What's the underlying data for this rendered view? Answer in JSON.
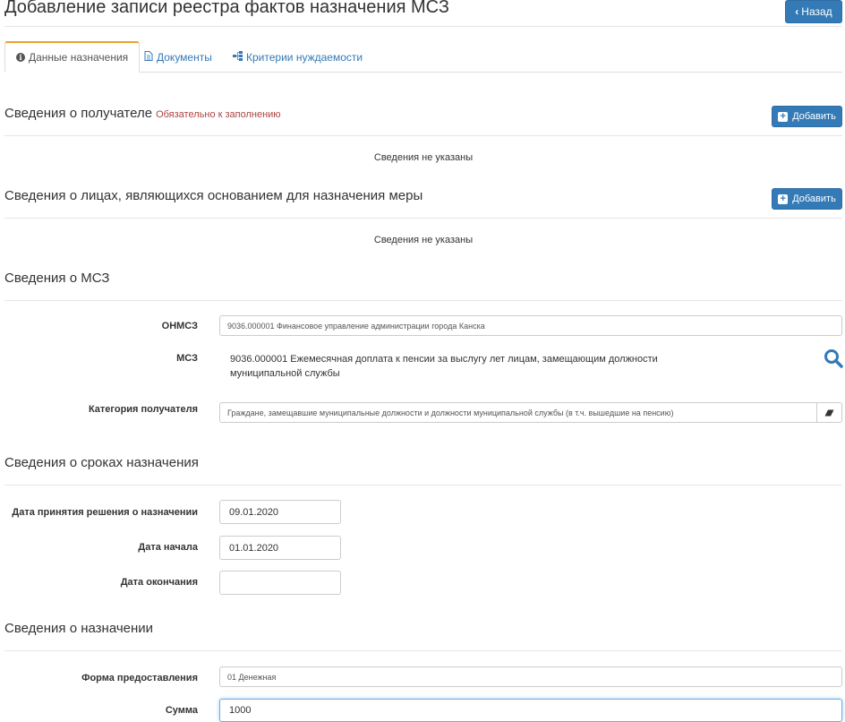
{
  "page": {
    "title": "Добавление записи реестра фактов назначения МСЗ",
    "back_label": "Назад"
  },
  "tabs": [
    {
      "label": "Данные назначения",
      "icon": "info-circle-icon"
    },
    {
      "label": "Документы",
      "icon": "document-icon"
    },
    {
      "label": "Критерии нуждаемости",
      "icon": "sitemap-icon"
    }
  ],
  "recipient": {
    "title": "Сведения о получателе",
    "required_note": "Обязательно к заполнению",
    "add_label": "Добавить",
    "empty": "Сведения не указаны"
  },
  "persons": {
    "title": "Сведения о лицах, являющихся основанием для назначения меры",
    "add_label": "Добавить",
    "empty": "Сведения не указаны"
  },
  "msz": {
    "title": "Сведения о МСЗ",
    "onmsz_label": "ОНМСЗ",
    "onmsz_value": "9036.000001 Финансовое управление администрации города Канска",
    "msz_label": "МСЗ",
    "msz_value": "9036.000001 Ежемесячная доплата к пенсии за выслугу лет лицам, замещающим должности муниципальной службы",
    "category_label": "Категория получателя",
    "category_value": "Граждане, замещавшие муниципальные должности и должности муниципальной службы (в т.ч. вышедшие на пенсию)"
  },
  "terms": {
    "title": "Сведения о сроках назначения",
    "decision_date_label": "Дата принятия решения о назначении",
    "decision_date_value": "09.01.2020",
    "start_date_label": "Дата начала",
    "start_date_value": "01.01.2020",
    "end_date_label": "Дата окончания",
    "end_date_value": ""
  },
  "assignment": {
    "title": "Сведения о назначении",
    "form_label": "Форма предоставления",
    "form_value": "01 Денежная",
    "sum_label": "Сумма",
    "sum_value": "1000"
  },
  "colors": {
    "primary": "#337ab7",
    "required": "#a94442",
    "active_tab_accent": "#e9a331"
  }
}
